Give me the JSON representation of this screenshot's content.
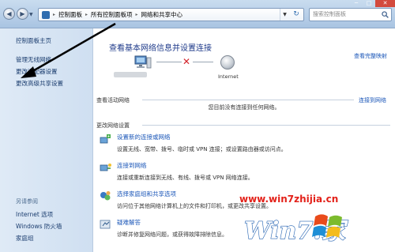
{
  "address_bar": {
    "crumbs": [
      "控制面板",
      "所有控制面板项",
      "网络和共享中心"
    ],
    "search_placeholder": "搜索控制面板"
  },
  "window_controls": {
    "minimize": "─",
    "maximize": "□",
    "close": "✕"
  },
  "sidebar": {
    "home": "控制面板主页",
    "links": [
      "管理无线网络",
      "更改适配器设置",
      "更改高级共享设置"
    ],
    "see_also_heading": "另请参阅",
    "see_also": [
      "Internet 选项",
      "Windows 防火墙",
      "家庭组"
    ]
  },
  "main": {
    "title": "查看基本网络信息并设置连接",
    "full_map_link": "查看完整映射",
    "internet_label": "Internet",
    "active_networks_label": "查看活动网络",
    "connect_link": "连接到网络",
    "no_connection_text": "您目前没有连接到任何网络。",
    "change_settings_label": "更改网络设置",
    "tasks": [
      {
        "title": "设置新的连接或网络",
        "desc": "设置无线、宽带、拨号、临时或 VPN 连接；或设置路由器或访问点。"
      },
      {
        "title": "连接到网络",
        "desc": "连接或重新连接到无线、有线、拨号或 VPN 网络连接。"
      },
      {
        "title": "选择家庭组和共享选项",
        "desc": "访问位于其他网络计算机上的文件和打印机，或更改共享设置。"
      },
      {
        "title": "疑难解答",
        "desc": "诊断并修复网络问题，或获得故障排除信息。"
      }
    ]
  },
  "watermark": {
    "url": "www.win7zhijia.cn",
    "logo_text": "Win7.家"
  },
  "colors": {
    "link": "#1a56b8",
    "title": "#1e3a8a",
    "error_x": "#d2232a",
    "watermark_red": "#e32119"
  }
}
